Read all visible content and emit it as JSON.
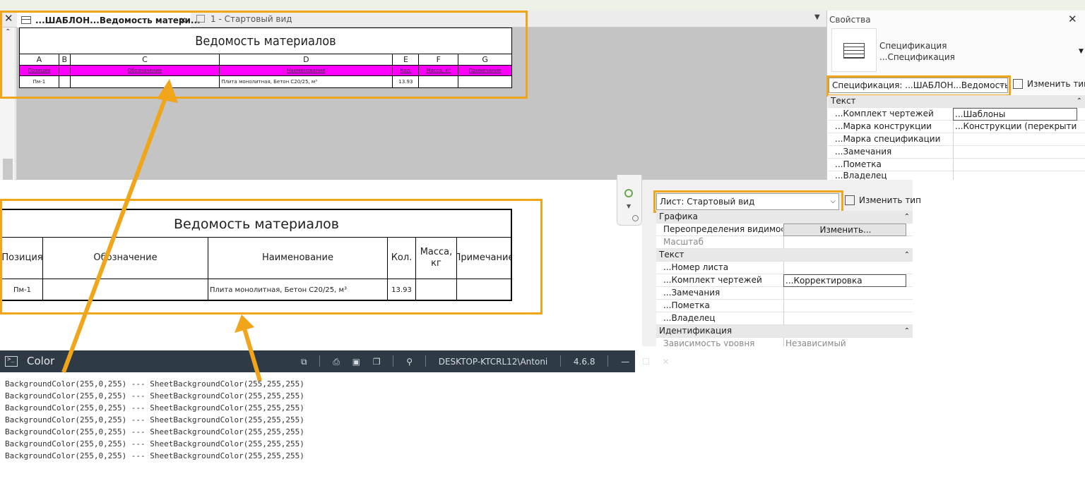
{
  "tabs": [
    {
      "label": "...ШАБЛОН...Ведомость матери...",
      "active": true,
      "close": "✕"
    },
    {
      "label": "1 - Стартовый вид",
      "active": false
    }
  ],
  "view_close": "✕",
  "schedule_small": {
    "title": "Ведомость материалов",
    "letters": [
      "A",
      "B",
      "C",
      "D",
      "E",
      "F",
      "G"
    ],
    "headers": [
      "Позиция",
      "",
      "Обозначение",
      "Наименование",
      "Кол.",
      "Масса, кг",
      "Примечание"
    ],
    "row": [
      "Пм-1",
      "",
      "",
      "Плита монолитная, Бетон С20/25, м³",
      "13.93",
      "",
      ""
    ],
    "header_color": "#ff00ff"
  },
  "properties_top": {
    "header": "Свойства",
    "type_line1": "Спецификация",
    "type_line2": "...Спецификация",
    "selector": "Спецификация: ...ШАБЛОН...Ведомость ма",
    "edit_type": "Изменить тип",
    "section": "Текст",
    "rows": [
      {
        "k": "...Комплект чертежей",
        "v": "...Шаблоны"
      },
      {
        "k": "...Марка конструкции",
        "v": "...Конструкции (перекрытия)"
      },
      {
        "k": "...Марка спецификации",
        "v": ""
      },
      {
        "k": "...Замечания",
        "v": ""
      },
      {
        "k": "...Пометка",
        "v": ""
      },
      {
        "k": "...Владелец",
        "v": ""
      }
    ]
  },
  "schedule_big": {
    "title": "Ведомость материалов",
    "headers": [
      "Позиция",
      "Обозначение",
      "Наименование",
      "Кол.",
      "Масса, кг",
      "Примечание"
    ],
    "row": [
      "Пм-1",
      "",
      "Плита монолитная, Бетон С20/25, м³",
      "13.93",
      "",
      ""
    ]
  },
  "properties_bottom": {
    "selector": "Лист: Стартовый вид",
    "edit_type": "Изменить тип",
    "sections": {
      "graphics": "Графика",
      "text": "Текст",
      "identity": "Идентификация"
    },
    "graphics_rows": [
      {
        "k": "Переопределения видимост...",
        "v": "Изменить..."
      },
      {
        "k": "Масштаб",
        "v": ""
      }
    ],
    "text_rows": [
      {
        "k": "...Номер листа",
        "v": ""
      },
      {
        "k": "...Комплект чертежей",
        "v": "...Корректировка"
      },
      {
        "k": "...Замечания",
        "v": ""
      },
      {
        "k": "...Пометка",
        "v": ""
      },
      {
        "k": "...Владелец",
        "v": ""
      }
    ],
    "identity_rows": [
      {
        "k": "Зависимость уровня",
        "v": "Независимый"
      }
    ]
  },
  "console": {
    "title": "Color",
    "machine": "DESKTOP-KTCRL12\\Antoni",
    "version": "4.6.8",
    "lines": [
      "BackgroundColor(255,0,255) --- SheetBackgroundColor(255,255,255)",
      "BackgroundColor(255,0,255) --- SheetBackgroundColor(255,255,255)",
      "BackgroundColor(255,0,255) --- SheetBackgroundColor(255,255,255)",
      "BackgroundColor(255,0,255) --- SheetBackgroundColor(255,255,255)",
      "BackgroundColor(255,0,255) --- SheetBackgroundColor(255,255,255)",
      "BackgroundColor(255,0,255) --- SheetBackgroundColor(255,255,255)",
      "BackgroundColor(255,0,255) --- SheetBackgroundColor(255,255,255)"
    ]
  },
  "colors": {
    "annotation": "#f0a51a",
    "console_bar": "#2e3b47",
    "magenta": "#ff00ff"
  }
}
